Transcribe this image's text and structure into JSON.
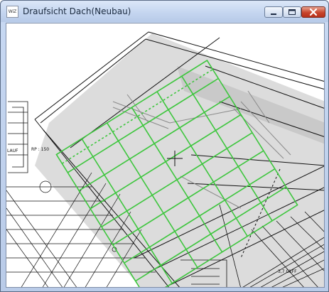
{
  "window": {
    "title": "Draufsicht Dach(Neubau)",
    "icon_text": "WiZ",
    "controls": {
      "minimize": "minimize-icon",
      "maximize": "maximize-icon",
      "close": "close-icon"
    }
  },
  "drawing": {
    "labels": {
      "lauf": "LAUF",
      "rp": "RP : 150",
      "level": "3,7 OkFF"
    },
    "cursor": "crosshair-icon",
    "colors": {
      "roof_grid": "#3ec63e",
      "roof_fill": "#d6d6d6",
      "line": "#111111"
    }
  }
}
